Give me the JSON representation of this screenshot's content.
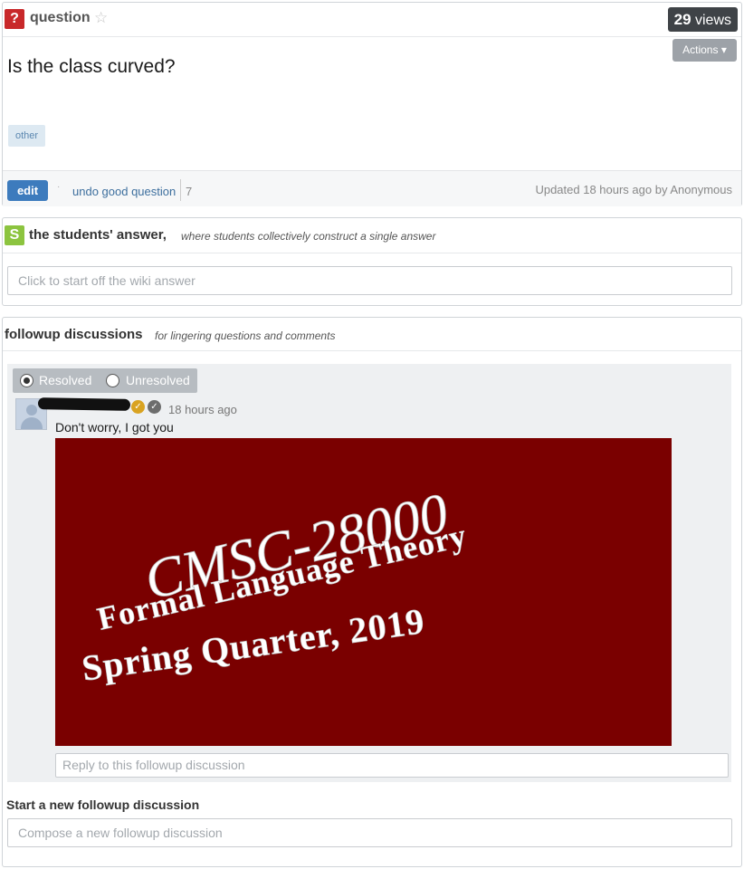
{
  "question": {
    "type_label": "question",
    "star_icon": "star-icon",
    "views_count": "29",
    "views_label": "views",
    "actions_label": "Actions",
    "title": "Is the class curved?",
    "tag": "other",
    "edit_label": "edit",
    "undo_good_label": "undo good question",
    "good_count": "7",
    "updated_text": "Updated 18 hours ago by Anonymous"
  },
  "students_answer": {
    "icon_letter": "S",
    "title": "the students' answer,",
    "subtitle": "where students collectively construct a single answer",
    "placeholder": "Click to start off the wiki answer"
  },
  "followups": {
    "title": "followup discussions",
    "subtitle": "for lingering questions and comments",
    "resolved_label": "Resolved",
    "unresolved_label": "Unresolved",
    "selected_status": "Resolved",
    "post": {
      "time": "18 hours ago",
      "text": "Don't worry, I got you",
      "image_lines": [
        "CMSC-28000",
        "Formal Language Theory",
        "Spring Quarter, 2019"
      ]
    },
    "reply_placeholder": "Reply to this followup discussion",
    "new_followup_label": "Start a new followup discussion",
    "compose_placeholder": "Compose a new followup discussion"
  },
  "colors": {
    "question_icon": "#c8282a",
    "students_icon": "#8cc43f",
    "edit_button": "#3d7bbd",
    "image_background": "#7a0000"
  }
}
